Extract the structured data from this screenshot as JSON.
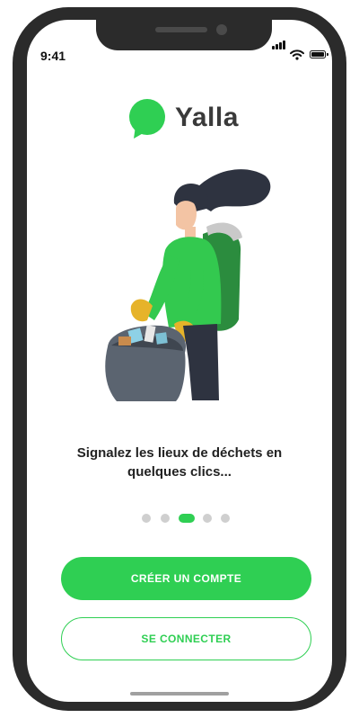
{
  "status_bar": {
    "time": "9:41"
  },
  "brand": {
    "name": "Yalla",
    "color": "#2fcf53"
  },
  "onboarding": {
    "tagline_line1": "Signalez les lieux de déchets en",
    "tagline_line2": "quelques clics...",
    "pages_total": 5,
    "active_page": 3
  },
  "actions": {
    "create_account_label": "CRÉER UN COMPTE",
    "login_label": "SE CONNECTER"
  },
  "colors": {
    "accent": "#2fcf53",
    "device_frame": "#2b2b2b",
    "text": "#222222",
    "dot_inactive": "#cfcfcf"
  }
}
